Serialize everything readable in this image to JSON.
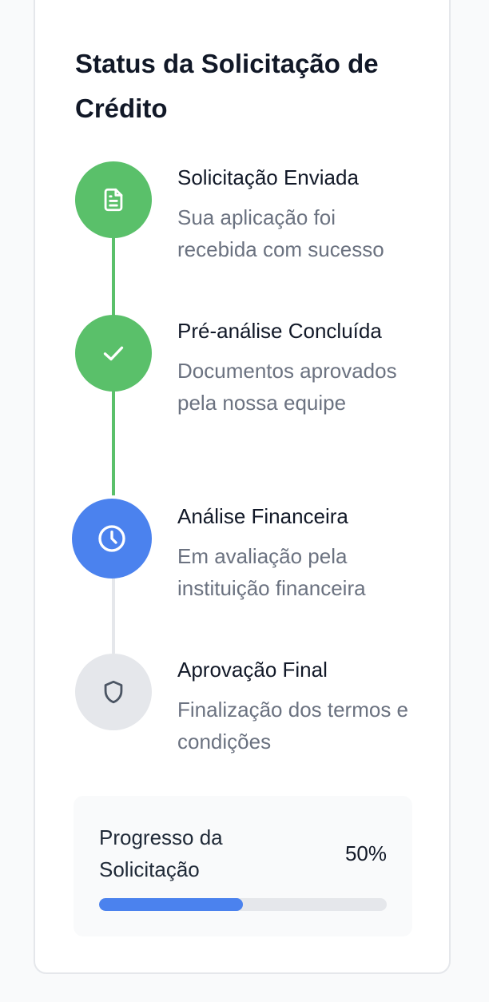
{
  "title": "Status da Solicitação de Crédito",
  "colors": {
    "completed": "#5ac06a",
    "active": "#4b82ee",
    "pending": "#e5e7eb",
    "pending_icon": "#4b5563",
    "connector_pending": "#e5e7eb"
  },
  "steps": [
    {
      "title": "Solicitação Enviada",
      "description": "Sua aplicação foi recebida com sucesso",
      "status": "completed",
      "icon": "document-icon"
    },
    {
      "title": "Pré-análise Concluída",
      "description": "Documentos aprovados pela nossa equipe",
      "status": "completed",
      "icon": "check-icon"
    },
    {
      "title": "Análise Financeira",
      "description": "Em avaliação pela instituição financeira",
      "status": "active",
      "icon": "clock-icon"
    },
    {
      "title": "Aprovação Final",
      "description": "Finalização dos termos e condições",
      "status": "pending",
      "icon": "shield-icon"
    }
  ],
  "progress": {
    "label": "Progresso da Solicitação",
    "percent_text": "50%",
    "value": 0.5
  }
}
